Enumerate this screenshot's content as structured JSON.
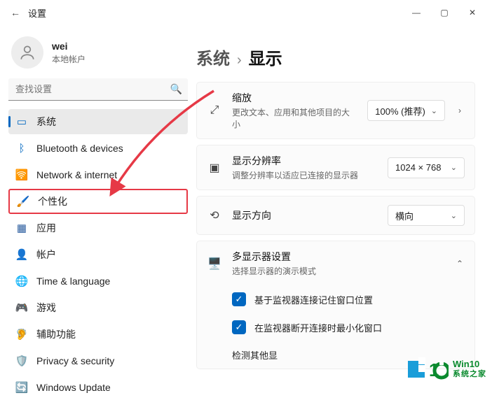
{
  "window": {
    "title": "设置"
  },
  "user": {
    "name": "wei",
    "type": "本地帐户"
  },
  "search": {
    "placeholder": "查找设置"
  },
  "sidebar": {
    "items": [
      {
        "label": "系统"
      },
      {
        "label": "Bluetooth & devices"
      },
      {
        "label": "Network & internet"
      },
      {
        "label": "个性化"
      },
      {
        "label": "应用"
      },
      {
        "label": "帐户"
      },
      {
        "label": "Time & language"
      },
      {
        "label": "游戏"
      },
      {
        "label": "辅助功能"
      },
      {
        "label": "Privacy & security"
      },
      {
        "label": "Windows Update"
      }
    ]
  },
  "breadcrumb": {
    "parent": "系统",
    "current": "显示"
  },
  "settings": {
    "scale": {
      "title": "缩放",
      "desc": "更改文本、应用和其他项目的大小",
      "value": "100% (推荐)"
    },
    "resolution": {
      "title": "显示分辨率",
      "desc": "调整分辨率以适应已连接的显示器",
      "value": "1024 × 768"
    },
    "orientation": {
      "title": "显示方向",
      "value": "横向"
    },
    "multi": {
      "title": "多显示器设置",
      "desc": "选择显示器的演示模式",
      "opt1": "基于监视器连接记住窗口位置",
      "opt2": "在监视器断开连接时最小化窗口",
      "opt3": "检测其他显"
    }
  },
  "watermark": {
    "line1": "Win10",
    "line2": "系统之家"
  }
}
